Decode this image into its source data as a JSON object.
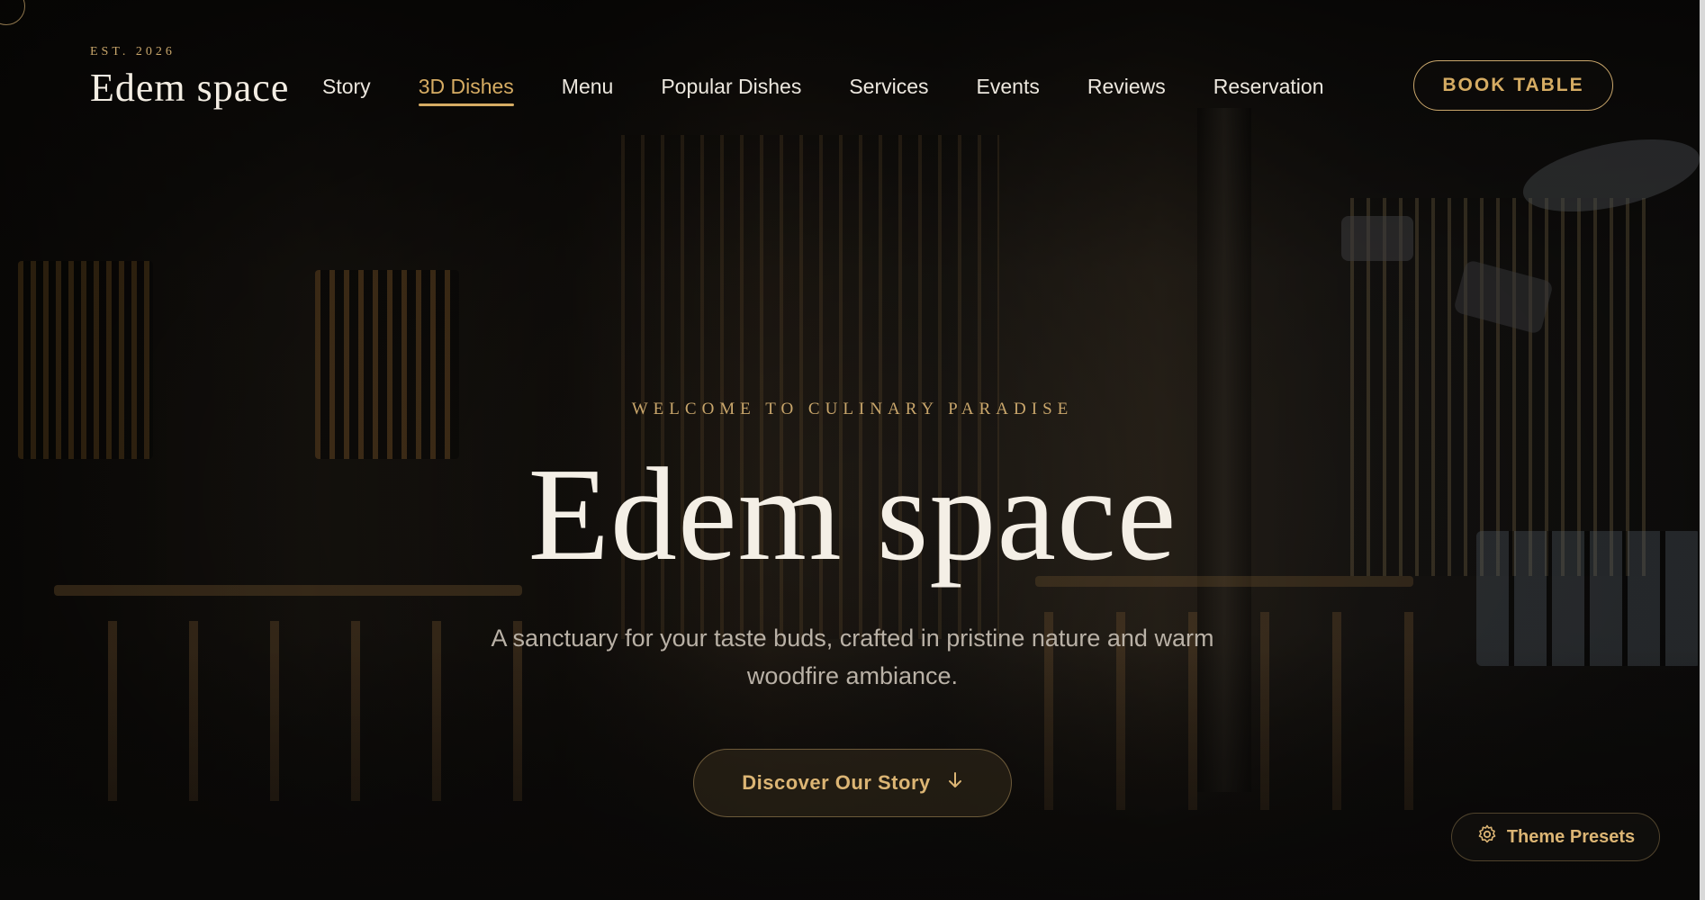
{
  "brand": {
    "est": "EST. 2026",
    "name": "Edem space"
  },
  "nav": {
    "items": [
      {
        "label": "Story",
        "active": false
      },
      {
        "label": "3D Dishes",
        "active": true
      },
      {
        "label": "Menu",
        "active": false
      },
      {
        "label": "Popular Dishes",
        "active": false
      },
      {
        "label": "Services",
        "active": false
      },
      {
        "label": "Events",
        "active": false
      },
      {
        "label": "Reviews",
        "active": false
      },
      {
        "label": "Reservation",
        "active": false
      }
    ],
    "book_label": "BOOK TABLE"
  },
  "hero": {
    "eyebrow": "WELCOME TO CULINARY PARADISE",
    "title": "Edem space",
    "subtitle_line1": "A sanctuary for your taste buds, crafted in pristine nature and warm",
    "subtitle_line2": "woodfire ambiance.",
    "cta_label": "Discover Our Story",
    "cta_icon": "arrow-down-icon"
  },
  "theme": {
    "label": "Theme Presets",
    "icon": "gear-icon"
  },
  "colors": {
    "accent": "#c9a66b",
    "text": "#f4efe6",
    "background": "#0c0b0a"
  }
}
